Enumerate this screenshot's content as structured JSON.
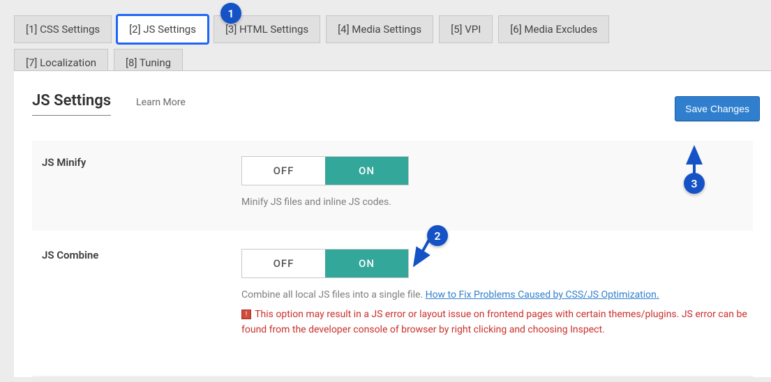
{
  "tabs": {
    "row1": [
      {
        "label": "[1] CSS Settings"
      },
      {
        "label": "[2] JS Settings"
      },
      {
        "label": "[3] HTML Settings"
      },
      {
        "label": "[4] Media Settings"
      },
      {
        "label": "[5] VPI"
      },
      {
        "label": "[6] Media Excludes"
      }
    ],
    "row2": [
      {
        "label": "[7] Localization"
      },
      {
        "label": "[8] Tuning"
      }
    ]
  },
  "section": {
    "title": "JS Settings",
    "learn_more": "Learn More"
  },
  "save_button": "Save Changes",
  "toggle": {
    "off": "OFF",
    "on": "ON"
  },
  "fields": {
    "minify": {
      "label": "JS Minify",
      "desc": "Minify JS files and inline JS codes."
    },
    "combine": {
      "label": "JS Combine",
      "desc_prefix": "Combine all local JS files into a single file. ",
      "desc_link": "How to Fix Problems Caused by CSS/JS Optimization.",
      "warn": "This option may result in a JS error or layout issue on frontend pages with certain themes/plugins. JS error can be found from the developer console of browser by right clicking and choosing Inspect."
    }
  },
  "markers": {
    "m1": "1",
    "m2": "2",
    "m3": "3"
  }
}
